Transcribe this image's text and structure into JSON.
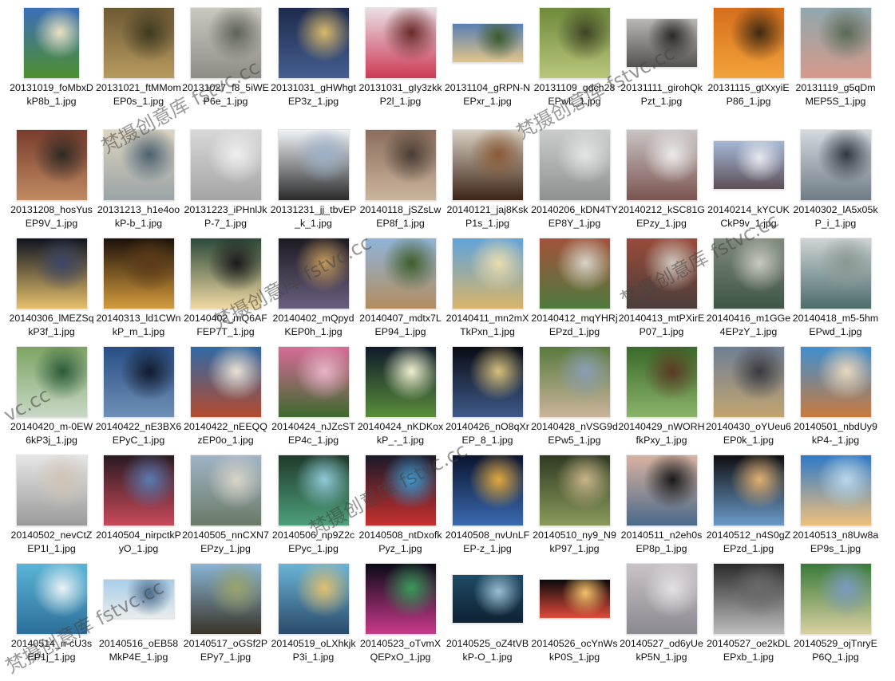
{
  "files": [
    {
      "name": "20131019_foMbxDkP8b_1.jpg",
      "shape": "portrait",
      "colors": [
        "#3a6fb8",
        "#4f8f2e",
        "#e9e2c4"
      ]
    },
    {
      "name": "20131021_ftMMomEP0s_1.jpg",
      "colors": [
        "#6e5a34",
        "#b79a5e",
        "#3f3a22"
      ]
    },
    {
      "name": "20131027_f8_5iWEP6e_1.jpg",
      "colors": [
        "#c9c8be",
        "#8d8d86",
        "#5f6356"
      ]
    },
    {
      "name": "20131031_gHWhgtEP3z_1.jpg",
      "colors": [
        "#1d2a4d",
        "#455f90",
        "#d8b96a"
      ]
    },
    {
      "name": "20131031_gIy3zkkP2l_1.jpg",
      "colors": [
        "#e9dfe4",
        "#cc3a56",
        "#6a2a2a"
      ]
    },
    {
      "name": "20131104_gRPN-NEPxr_1.jpg",
      "shape": "land",
      "colors": [
        "#5a7fb3",
        "#e0c48a",
        "#3c5a2e"
      ]
    },
    {
      "name": "20131109_gdch28EPwL_1.jpg",
      "colors": [
        "#6f8a3b",
        "#b9c67b",
        "#3e4526"
      ]
    },
    {
      "name": "20131111_girohQkPzt_1.jpg",
      "shape": "wide",
      "colors": [
        "#b8b6b3",
        "#555350",
        "#2b2a29"
      ]
    },
    {
      "name": "20131115_gtXxyiEP86_1.jpg",
      "colors": [
        "#d66d1a",
        "#f2a33b",
        "#3f2a12"
      ]
    },
    {
      "name": "20131119_g5qDmMEP5S_1.jpg",
      "colors": [
        "#8fa7ad",
        "#d69a8b",
        "#5a6a56"
      ]
    },
    {
      "name": "20131208_hosYusEP9V_1.jpg",
      "colors": [
        "#7a3c2d",
        "#c08b62",
        "#2f2a24"
      ]
    },
    {
      "name": "20131213_h1e4ookP-b_1.jpg",
      "colors": [
        "#dcd4c0",
        "#9aa3a6",
        "#4a6070"
      ]
    },
    {
      "name": "20131223_iPHnlJkP-7_1.jpg",
      "colors": [
        "#d7d7d7",
        "#a4a4a4",
        "#efefef"
      ]
    },
    {
      "name": "20131231_jj_tbvEP_k_1.jpg",
      "colors": [
        "#eef2f6",
        "#2a2a2a",
        "#9bb0c8"
      ]
    },
    {
      "name": "20140118_jSZsLwEP8f_1.jpg",
      "colors": [
        "#8b6e5c",
        "#cbb59d",
        "#4a3d35"
      ]
    },
    {
      "name": "20140121_jaj8KskP1s_1.jpg",
      "colors": [
        "#d8d0c3",
        "#3c2417",
        "#8a5a36"
      ]
    },
    {
      "name": "20140206_kDN4TYEP8Y_1.jpg",
      "colors": [
        "#c9cccb",
        "#8e9190",
        "#e4e6e5"
      ]
    },
    {
      "name": "20140212_kSC81GEPzy_1.jpg",
      "colors": [
        "#c9c4c4",
        "#7a5450",
        "#ecebea"
      ]
    },
    {
      "name": "20140214_kYCUKCkP9v_1.jpg",
      "shape": "wide",
      "colors": [
        "#a3b7d6",
        "#5d4f57",
        "#e6e9ee"
      ]
    },
    {
      "name": "20140302_lA5x05kP_i_1.jpg",
      "colors": [
        "#d3d9de",
        "#6f7c86",
        "#2f3a40"
      ]
    },
    {
      "name": "20140306_lMEZSqkP3f_1.jpg",
      "colors": [
        "#0f1420",
        "#e6c06a",
        "#3f4766"
      ]
    },
    {
      "name": "20140313_ld1CWnkP_m_1.jpg",
      "colors": [
        "#1c120a",
        "#d49b3d",
        "#5d3b18"
      ]
    },
    {
      "name": "20140402_mQ6AFFEP7T_1.jpg",
      "colors": [
        "#2b4a3a",
        "#f0d9a2",
        "#1b1a1b"
      ]
    },
    {
      "name": "20140402_mQpydKEP0h_1.jpg",
      "colors": [
        "#1d1a22",
        "#6b5f80",
        "#c39a5a"
      ]
    },
    {
      "name": "20140407_mdtx7LEP94_1.jpg",
      "colors": [
        "#8fb4d9",
        "#b38d5e",
        "#3e5d2d"
      ]
    },
    {
      "name": "20140411_mn2mXTkPxn_1.jpg",
      "colors": [
        "#5fa3da",
        "#d8b46a",
        "#eadcae"
      ]
    },
    {
      "name": "20140412_mqYHRjEPzd_1.jpg",
      "colors": [
        "#a2533b",
        "#4e7a3c",
        "#d8d2c8"
      ]
    },
    {
      "name": "20140413_mtPXirEP07_1.jpg",
      "colors": [
        "#9a4b3a",
        "#4a3d3a",
        "#cfc6bc"
      ]
    },
    {
      "name": "20140416_m1GGe4EPzY_1.jpg",
      "colors": [
        "#7e8a7a",
        "#3f5545",
        "#c8c9bf"
      ]
    },
    {
      "name": "20140418_m5-5hmEPwd_1.jpg",
      "colors": [
        "#cdd4d6",
        "#4c6c6a",
        "#8a9792"
      ]
    },
    {
      "name": "20140420_m-0EW6kP3j_1.jpg",
      "colors": [
        "#7da463",
        "#c8d8c6",
        "#2d5a3a"
      ]
    },
    {
      "name": "20140422_nE3BX6EPyC_1.jpg",
      "colors": [
        "#284e85",
        "#6f90b6",
        "#121a2d"
      ]
    },
    {
      "name": "20140422_nEEQQzEP0o_1.jpg",
      "colors": [
        "#2f6aa6",
        "#b44b2e",
        "#e8e2d6"
      ]
    },
    {
      "name": "20140424_nJZcSTEP4c_1.jpg",
      "colors": [
        "#d66b98",
        "#3e6a2e",
        "#e9b4c8"
      ]
    },
    {
      "name": "20140424_nKDKoxkP_-_1.jpg",
      "colors": [
        "#0f1a2b",
        "#5a8e3a",
        "#f0f0d0"
      ]
    },
    {
      "name": "20140426_nO8qXrEP_8_1.jpg",
      "colors": [
        "#0a0c14",
        "#3d5a8a",
        "#d7c07a"
      ]
    },
    {
      "name": "20140428_nVSG9dEPw5_1.jpg",
      "colors": [
        "#5a7a3e",
        "#c9b49a",
        "#8a9eb5"
      ]
    },
    {
      "name": "20140429_nWORHfkPxy_1.jpg",
      "colors": [
        "#3a6a2a",
        "#8bb36a",
        "#5a3a24"
      ]
    },
    {
      "name": "20140430_oYUeu6EP0k_1.jpg",
      "colors": [
        "#6f7f95",
        "#c2a46e",
        "#3b3a40"
      ]
    },
    {
      "name": "20140501_nbdUy9kP4-_1.jpg",
      "colors": [
        "#3f8fd0",
        "#c97a3c",
        "#e9d7bd"
      ]
    },
    {
      "name": "20140502_nevCtZEP1I_1.jpg",
      "colors": [
        "#e6e6e6",
        "#9a9a9a",
        "#cfc4b5"
      ]
    },
    {
      "name": "20140504_nirpctkPyO_1.jpg",
      "colors": [
        "#2a1a22",
        "#c84a5a",
        "#5a7ab0"
      ]
    },
    {
      "name": "20140505_nnCXN7EPzy_1.jpg",
      "colors": [
        "#9fb4c8",
        "#6a7a66",
        "#d9d4c8"
      ]
    },
    {
      "name": "20140506_np9Z2cEPyc_1.jpg",
      "colors": [
        "#1f3a2a",
        "#4ea07a",
        "#8fc9d8"
      ]
    },
    {
      "name": "20140508_ntDxofkPyz_1.jpg",
      "colors": [
        "#1a1a2a",
        "#c8302e",
        "#3a9ad0"
      ]
    },
    {
      "name": "20140508_nvUnLFEP-z_1.jpg",
      "colors": [
        "#0a1430",
        "#3a6ab0",
        "#e2a83c"
      ]
    },
    {
      "name": "20140510_ny9_N9kP97_1.jpg",
      "colors": [
        "#2f3a22",
        "#8a9a5a",
        "#c8b48a"
      ]
    },
    {
      "name": "20140511_n2eh0sEP8p_1.jpg",
      "colors": [
        "#d9b2a0",
        "#4a6a8a",
        "#1a1a1a"
      ]
    },
    {
      "name": "20140512_n4S0gZEPzd_1.jpg",
      "colors": [
        "#0f0f12",
        "#6a9ac8",
        "#e0b070"
      ]
    },
    {
      "name": "20140513_n8Uw8aEP9s_1.jpg",
      "colors": [
        "#2f7ac8",
        "#f0c07a",
        "#b9d6ea"
      ]
    },
    {
      "name": "20140514_n-cU3sEP1j_1.jpg",
      "colors": [
        "#5ab4d6",
        "#2c6f9a",
        "#e9f3f6"
      ]
    },
    {
      "name": "20140516_oEB58MkP4E_1.jpg",
      "shape": "land",
      "colors": [
        "#a8cde9",
        "#e8ecec",
        "#4b6c8a"
      ]
    },
    {
      "name": "20140517_oGSf2PEPy7_1.jpg",
      "colors": [
        "#89b4d6",
        "#3a3428",
        "#9aa46a"
      ]
    },
    {
      "name": "20140519_oLXhkjkP3i_1.jpg",
      "colors": [
        "#6ab4d6",
        "#2a4a6a",
        "#e0c070"
      ]
    },
    {
      "name": "20140523_oTvmXQEPxO_1.jpg",
      "colors": [
        "#0a0a18",
        "#c83a8a",
        "#3a9a5a"
      ]
    },
    {
      "name": "20140525_oZ4tVBkP-O_1.jpg",
      "shape": "wide",
      "colors": [
        "#1f4a66",
        "#0e2232",
        "#9abed0"
      ]
    },
    {
      "name": "20140526_ocYnWskP0S_1.jpg",
      "shape": "land",
      "colors": [
        "#0a0a0a",
        "#e04a3a",
        "#f2c06a"
      ]
    },
    {
      "name": "20140527_od6yUekP5N_1.jpg",
      "colors": [
        "#c9c2c6",
        "#8a8890",
        "#e4e0e2"
      ]
    },
    {
      "name": "20140527_oe2kDLEPxb_1.jpg",
      "colors": [
        "#2a2a2a",
        "#bdbdbd",
        "#6a6a6a"
      ]
    },
    {
      "name": "20140529_ojTnryEP6Q_1.jpg",
      "colors": [
        "#3a7a3a",
        "#d8d0a0",
        "#7a9ac0"
      ]
    }
  ],
  "watermarks": [
    "梵摄创意库 fstvc.cc",
    "梵摄创意库 fstvc.cc",
    "梵摄创意库 fstvc.cc",
    "梵摄创意库 fstvc.cc",
    "梵摄创意库 fstvc.cc",
    "vc.cc",
    "梵摄创意库 fstvc.cc"
  ]
}
